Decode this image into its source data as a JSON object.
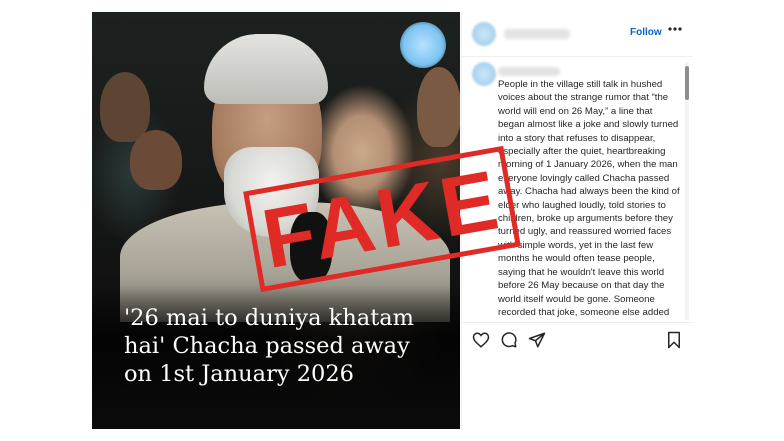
{
  "video": {
    "caption": "'26 mai to duniya khatam hai' Chacha passed away on 1st January 2026",
    "stamp_text": "FAKE",
    "stamp_color": "#e02a25"
  },
  "post": {
    "follow_label": "Follow",
    "more_icon": "more-horizontal-icon",
    "body": "People in the village still talk in hushed voices about the strange rumor that “the world will end on 26 May,” a line that began almost like a joke and slowly turned into a story that refuses to disappear, especially after the quiet, heartbreaking morning of 1 January 2026, when the man everyone lovingly called Chacha passed away. Chacha had always been the kind of elder who laughed loudly, told stories to children, broke up arguments before they turned ugly, and reassured worried faces with simple words, yet in the last few months he would often tease people, saying that he wouldn't leave this world before 26 May because on that day the world itself would be gone. Someone recorded that joke, someone else added dramatic music, the clip spread online"
  },
  "actions": {
    "like_icon": "heart-icon",
    "comment_icon": "comment-icon",
    "share_icon": "send-icon",
    "save_icon": "bookmark-icon"
  },
  "colors": {
    "link": "#0a63c9",
    "text": "#262626"
  }
}
